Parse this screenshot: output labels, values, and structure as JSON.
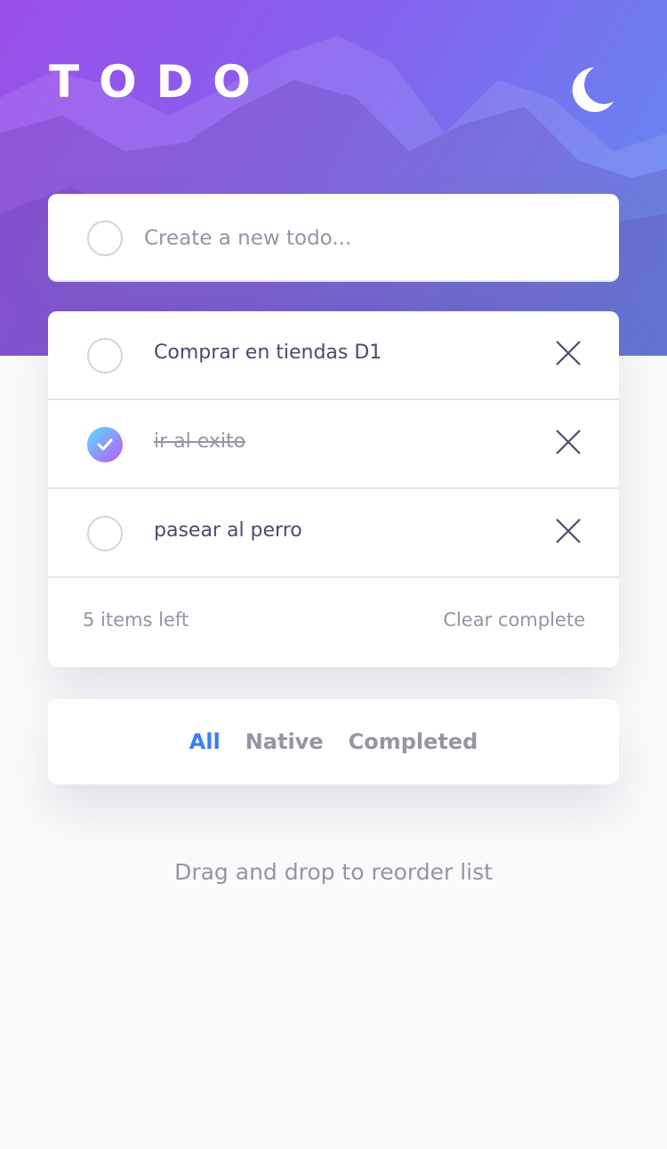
{
  "app": {
    "title": "TODO",
    "theme_icon": "moon-icon"
  },
  "new_todo": {
    "placeholder": "Create a new todo..."
  },
  "todos": [
    {
      "text": "Comprar en tiendas D1",
      "completed": false
    },
    {
      "text": "ir al exito",
      "completed": true
    },
    {
      "text": "pasear al perro",
      "completed": false
    }
  ],
  "footer": {
    "items_left": "5 items left",
    "clear": "Clear complete"
  },
  "filters": {
    "all": "All",
    "native": "Native",
    "completed": "Completed",
    "active": "All"
  },
  "hint": "Drag and drop to reorder list",
  "colors": {
    "accent": "#3a7cfd",
    "gradient_start": "#55ddff",
    "gradient_end": "#c058f3",
    "text": "#494c6b",
    "muted": "#9495a5"
  }
}
